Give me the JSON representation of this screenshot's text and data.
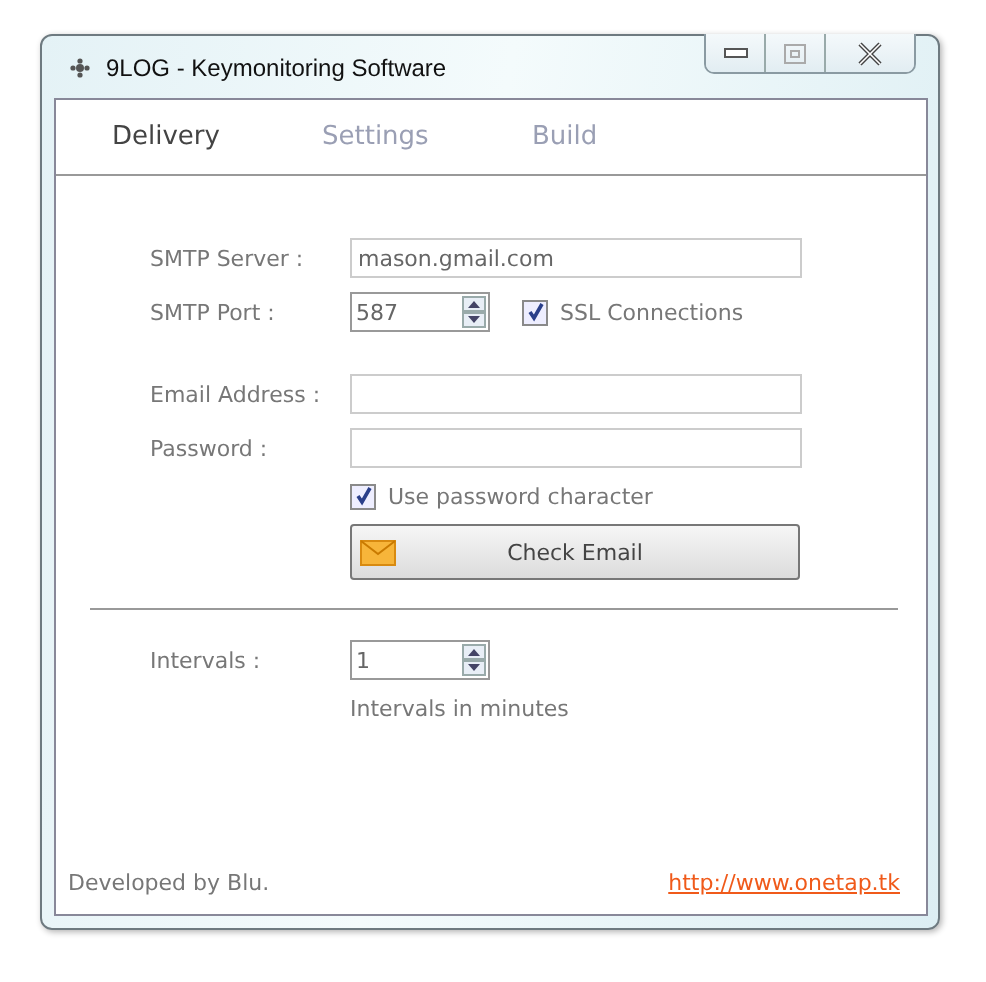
{
  "window": {
    "title": "9LOG - Keymonitoring Software"
  },
  "tabs": [
    {
      "label": "Delivery",
      "selected": true
    },
    {
      "label": "Settings",
      "selected": false
    },
    {
      "label": "Build",
      "selected": false
    }
  ],
  "smtp_server": {
    "label": "SMTP Server :",
    "value": "mason.gmail.com"
  },
  "smtp_port": {
    "label": "SMTP Port :",
    "value": "587"
  },
  "ssl": {
    "label": "SSL Connections",
    "checked": true
  },
  "email": {
    "label": "Email Address :"
  },
  "password": {
    "label": "Password :"
  },
  "use_password_char": {
    "label": "Use password character",
    "checked": true
  },
  "check_button": {
    "label": "Check Email"
  },
  "intervals": {
    "label": "Intervals :",
    "value": "1",
    "hint": "Intervals in minutes"
  },
  "footer": {
    "credit": "Developed by Blu.",
    "link": "http://www.onetap.tk"
  }
}
